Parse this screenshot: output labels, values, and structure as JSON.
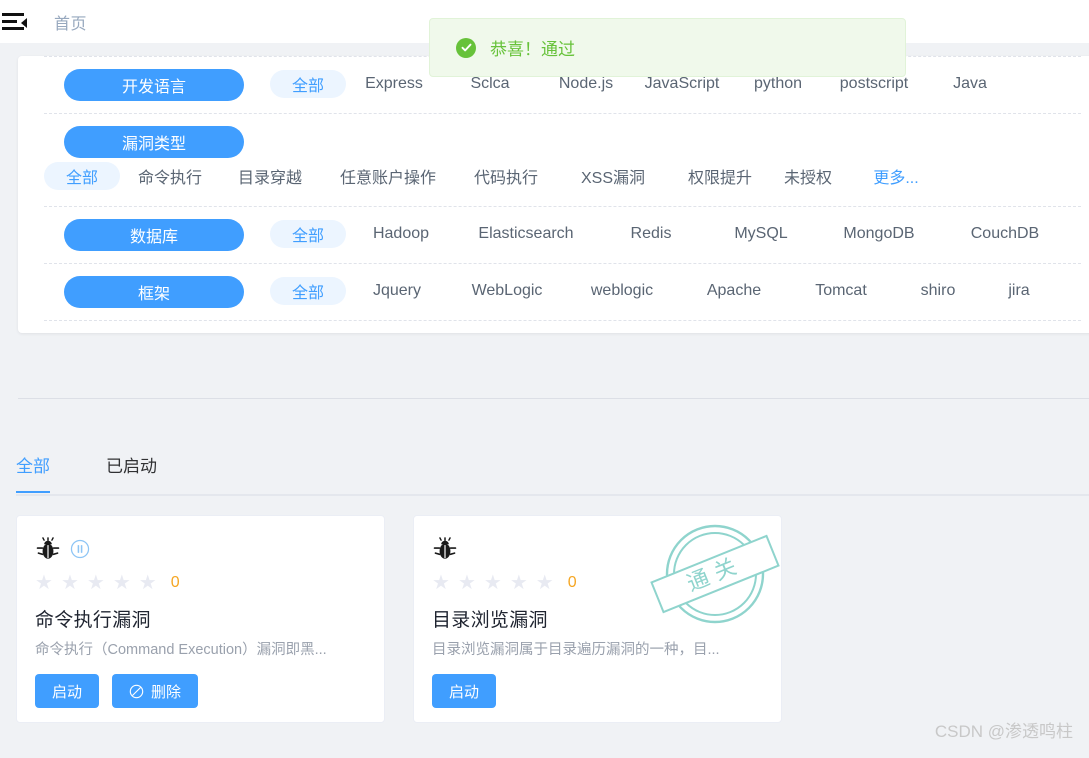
{
  "header": {
    "menu_icon": "hamburger-collapse-icon",
    "breadcrumb": "首页"
  },
  "toast": {
    "icon": "success-check-icon",
    "message": "恭喜！通过",
    "bg_color": "#f0f9eb",
    "text_color": "#67c23a"
  },
  "filters": {
    "accent_color": "#409eff",
    "rows": [
      {
        "category": "开发语言",
        "options": [
          "全部",
          "Express",
          "Sclca",
          "Node.js",
          "JavaScript",
          "python",
          "postscript",
          "Java"
        ]
      },
      {
        "category": "漏洞类型",
        "options": [
          "全部",
          "命令执行",
          "目录穿越",
          "任意账户操作",
          "代码执行",
          "XSS漏洞",
          "权限提升",
          "未授权",
          "更多..."
        ]
      },
      {
        "category": "数据库",
        "options": [
          "全部",
          "Hadoop",
          "Elasticsearch",
          "Redis",
          "MySQL",
          "MongoDB",
          "CouchDB"
        ]
      },
      {
        "category": "框架",
        "options": [
          "全部",
          "Jquery",
          "WebLogic",
          "weblogic",
          "Apache",
          "Tomcat",
          "shiro",
          "jira"
        ]
      }
    ]
  },
  "tabs": [
    {
      "label": "全部",
      "active": true
    },
    {
      "label": "已启动",
      "active": false
    }
  ],
  "cards": [
    {
      "bug_icon": "bug-icon",
      "status_icon": "pause-circle-icon",
      "stars": 5,
      "star_count": "0",
      "title": "命令执行漏洞",
      "description": "命令执行（Command Execution）漏洞即黑...",
      "buttons": [
        {
          "label": "启动",
          "icon": null
        },
        {
          "label": "删除",
          "icon": "prohibited-icon"
        }
      ],
      "stamp": null
    },
    {
      "bug_icon": "bug-icon",
      "status_icon": null,
      "stars": 5,
      "star_count": "0",
      "title": "目录浏览漏洞",
      "description": "目录浏览漏洞属于目录遍历漏洞的一种，目...",
      "buttons": [
        {
          "label": "启动",
          "icon": null
        }
      ],
      "stamp": {
        "text": "通关",
        "color": "#7fd1c8"
      }
    }
  ],
  "watermark": "CSDN @渗透鸣柱"
}
